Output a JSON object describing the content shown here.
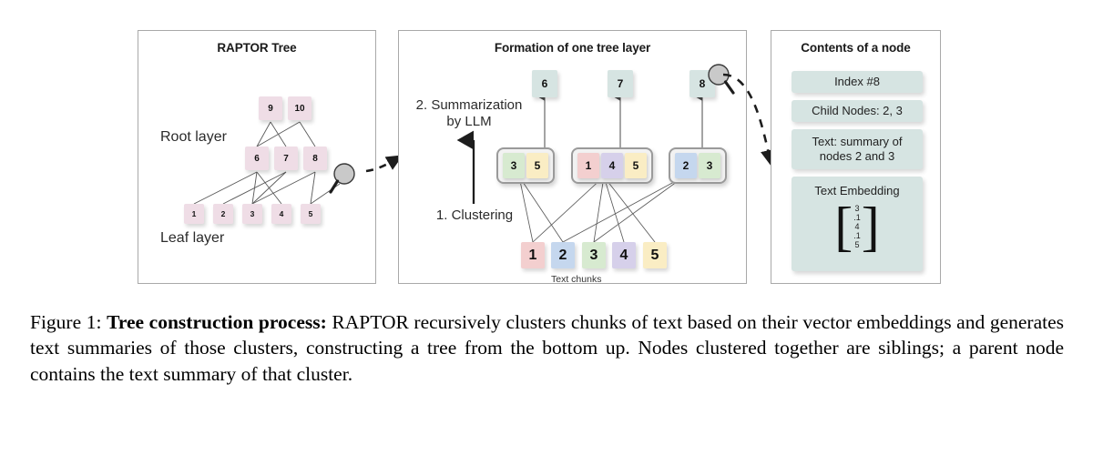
{
  "figure": {
    "panels": {
      "tree": {
        "title": "RAPTOR Tree",
        "labels": {
          "root": "Root layer",
          "leaf": "Leaf layer"
        },
        "root_nodes": [
          "9",
          "10"
        ],
        "mid_nodes": [
          "6",
          "7",
          "8"
        ],
        "leaf_nodes": [
          "1",
          "2",
          "3",
          "4",
          "5"
        ]
      },
      "layer": {
        "title": "Formation of one tree layer",
        "step2": "2. Summarization",
        "step2b": "by LLM",
        "step1": "1. Clustering",
        "summary_nodes": [
          "6",
          "7",
          "8"
        ],
        "clusters": [
          {
            "members": [
              "3",
              "5"
            ]
          },
          {
            "members": [
              "1",
              "4",
              "5"
            ]
          },
          {
            "members": [
              "2",
              "3"
            ]
          }
        ],
        "text_chunks": [
          "1",
          "2",
          "3",
          "4",
          "5"
        ],
        "chunks_caption": "Text chunks"
      },
      "node": {
        "title": "Contents of a node",
        "index": "Index #8",
        "child_nodes": "Child Nodes: 2, 3",
        "text_line1": "Text:  summary of",
        "text_line2": "nodes 2 and 3",
        "embedding_label": "Text Embedding",
        "embedding_values": [
          "3",
          ".1",
          "4",
          ".1",
          "5"
        ]
      }
    },
    "colors": {
      "pink_node": "#efdde6",
      "teal_node": "#d6e4e2",
      "chunk_1": "#f3cfcf",
      "chunk_2": "#c5d7ee",
      "chunk_3": "#d7ead0",
      "chunk_4": "#d6d0ea",
      "chunk_5": "#faedc4",
      "cluster_border": "#9a9a9a",
      "panel_border": "#a9a9a9",
      "edge": "#5a5a5a"
    }
  },
  "caption": {
    "figure_label": "Figure 1: ",
    "bold_lead": "Tree construction process:",
    "body": " RAPTOR recursively clusters chunks of text based on their vector embeddings and generates text summaries of those clusters, constructing a tree from the bottom up. Nodes clustered together are siblings; a parent node contains the text summary of that cluster."
  }
}
